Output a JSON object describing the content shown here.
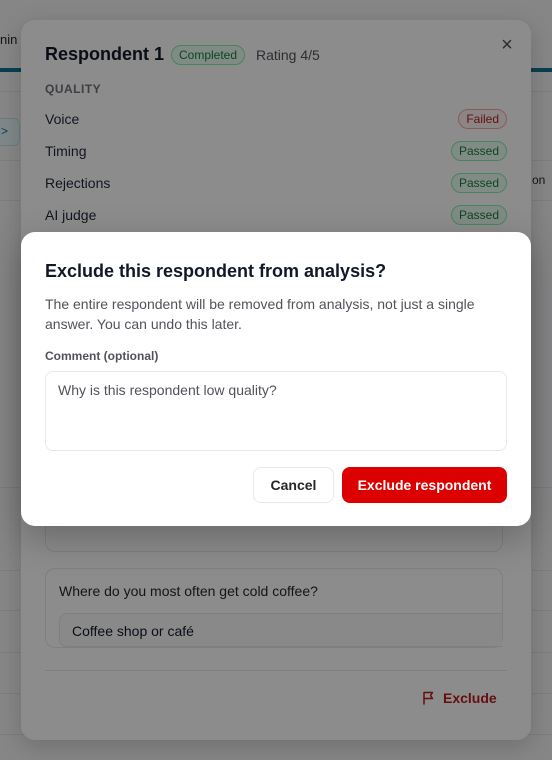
{
  "background": {
    "tab_partial": "nin",
    "chip_partial": ">",
    "right_partial": "on"
  },
  "drawer": {
    "title": "Respondent 1",
    "status_badge": "Completed",
    "rating": "Rating 4/5",
    "close_icon": "close-icon",
    "section_label": "QUALITY",
    "quality_checks": [
      {
        "name": "Voice",
        "status": "Failed"
      },
      {
        "name": "Timing",
        "status": "Passed"
      },
      {
        "name": "Rejections",
        "status": "Passed"
      },
      {
        "name": "AI judge",
        "status": "Passed"
      }
    ],
    "answers": [
      {
        "question": "Where do you most often get cold coffee?",
        "answer": "Coffee shop or café"
      }
    ],
    "exclude_label": "Exclude",
    "exclude_icon": "flag-icon"
  },
  "dialog": {
    "title": "Exclude this respondent from analysis?",
    "description": "The entire respondent will be removed from analysis, not just a single answer. You can undo this later.",
    "comment_label": "Comment (optional)",
    "comment_placeholder": "Why is this respondent low quality?",
    "comment_value": "",
    "cancel_label": "Cancel",
    "confirm_label": "Exclude respondent"
  },
  "colors": {
    "danger": "#dc0000",
    "passed": "#15803d",
    "failed": "#b91c1c",
    "accent": "#0e7490"
  }
}
